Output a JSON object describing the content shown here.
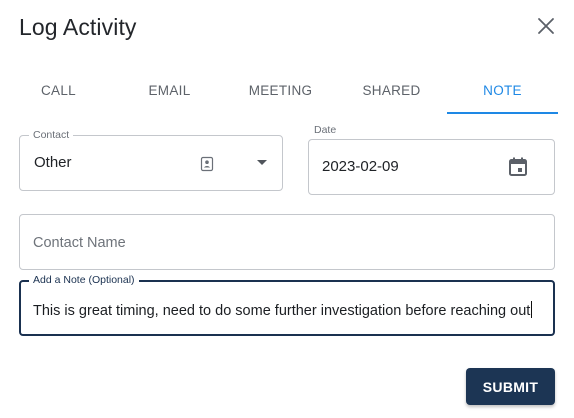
{
  "dialog": {
    "title": "Log Activity",
    "close_icon": "close-icon"
  },
  "tabs": [
    {
      "label": "CALL",
      "active": false
    },
    {
      "label": "EMAIL",
      "active": false
    },
    {
      "label": "MEETING",
      "active": false
    },
    {
      "label": "SHARED",
      "active": false
    },
    {
      "label": "NOTE",
      "active": true
    }
  ],
  "form": {
    "contact": {
      "label": "Contact",
      "value": "Other",
      "icons": [
        "contact-card-icon",
        "chevron-down-icon"
      ]
    },
    "date": {
      "label": "Date",
      "value": "2023-02-09",
      "icon": "calendar-icon"
    },
    "contact_name": {
      "placeholder": "Contact Name",
      "value": ""
    },
    "note": {
      "label": "Add a Note (Optional)",
      "value": "This is great timing, need to do some further investigation before reaching out"
    }
  },
  "actions": {
    "submit_label": "SUBMIT"
  },
  "colors": {
    "accent": "#1e88e5",
    "primary_button": "#1c3554",
    "focused_border": "#1a3150"
  }
}
